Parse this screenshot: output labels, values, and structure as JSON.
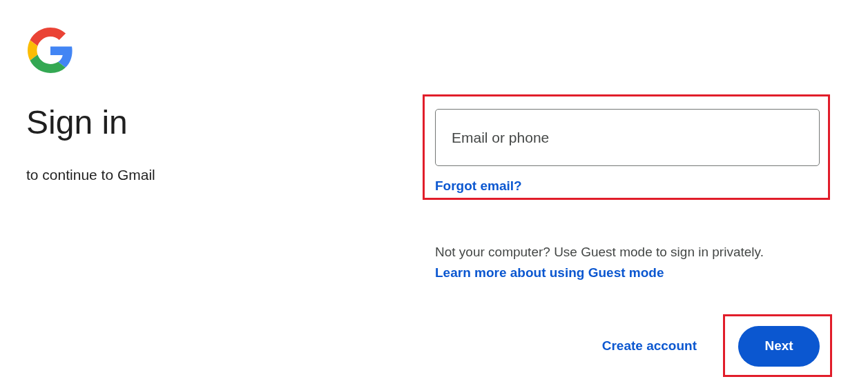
{
  "heading": "Sign in",
  "subtitle": "to continue to Gmail",
  "email_field": {
    "placeholder": "Email or phone"
  },
  "forgot_link": "Forgot email?",
  "guest_note": "Not your computer? Use Guest mode to sign in privately.",
  "guest_link": "Learn more about using Guest mode",
  "create_account": "Create account",
  "next_button": "Next"
}
